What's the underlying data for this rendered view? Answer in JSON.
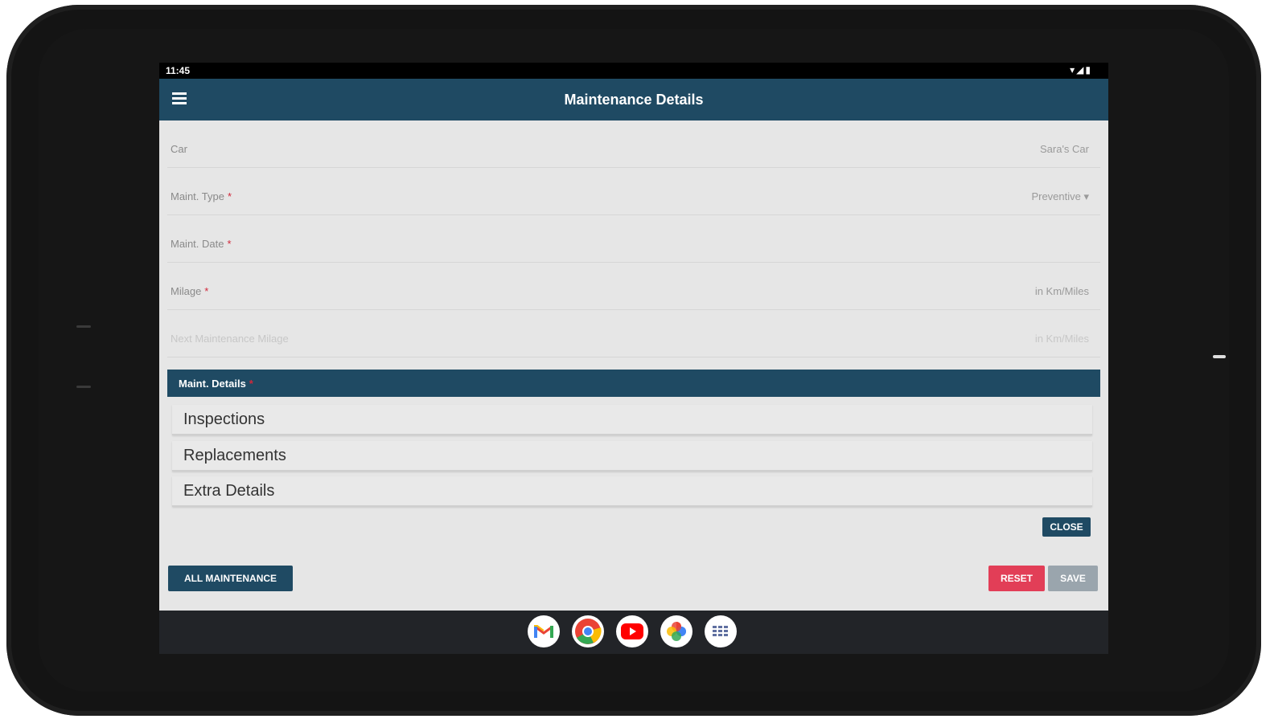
{
  "status_bar": {
    "time": "11:45",
    "icons": "▾◢▮"
  },
  "app_bar": {
    "title": "Maintenance Details"
  },
  "form": {
    "car": {
      "label": "Car",
      "value": "Sara's Car"
    },
    "maint_type": {
      "label": "Maint. Type",
      "required": "*",
      "value": "Preventive ▾"
    },
    "maint_date": {
      "label": "Maint. Date",
      "required": "*",
      "value": ""
    },
    "mileage": {
      "label": "Milage",
      "required": "*",
      "placeholder": "in Km/Miles"
    },
    "next_mileage": {
      "label": "Next Maintenance Milage",
      "placeholder": "in Km/Miles"
    }
  },
  "details_section": {
    "title": "Maint. Details",
    "required": "*",
    "items": [
      "Inspections",
      "Replacements",
      "Extra Details"
    ]
  },
  "buttons": {
    "close": "CLOSE",
    "all_maintenance": "ALL MAINTENANCE",
    "reset": "RESET",
    "save": "SAVE"
  },
  "dock_apps": [
    "gmail-icon",
    "chrome-icon",
    "youtube-icon",
    "photos-icon",
    "app-drawer-icon"
  ],
  "colors": {
    "primary": "#1f4a63",
    "danger": "#e23e57",
    "disabled": "#9aa5ad",
    "background": "#e6e6e6"
  }
}
